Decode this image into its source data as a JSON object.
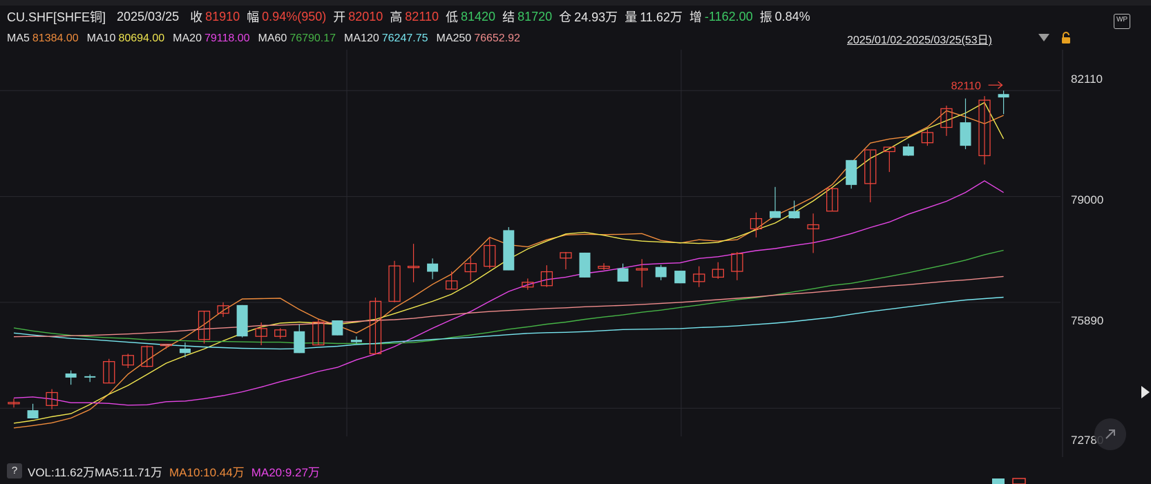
{
  "header": {
    "symbol": "CU.SHF[SHFE铜]",
    "date": "2025/03/25",
    "close_label": "收",
    "close_value": "81910",
    "range_label": "幅",
    "range_value": "0.94%(950)",
    "open_label": "开",
    "open_value": "82010",
    "high_label": "高",
    "high_value": "82110",
    "low_label": "低",
    "low_value": "81420",
    "settle_label": "结",
    "settle_value": "81720",
    "oi_label": "仓",
    "oi_value": "24.93万",
    "vol_label": "量",
    "vol_value": "11.62万",
    "incr_label": "增",
    "incr_value": "-1162.00",
    "amp_label": "振",
    "amp_value": "0.84%"
  },
  "ma_legend": [
    {
      "name": "MA5",
      "value": "81384.00",
      "color": "#f08c3c"
    },
    {
      "name": "MA10",
      "value": "80694.00",
      "color": "#f0e650"
    },
    {
      "name": "MA20",
      "value": "79118.00",
      "color": "#e646e6"
    },
    {
      "name": "MA60",
      "value": "76790.17",
      "color": "#46b446"
    },
    {
      "name": "MA120",
      "value": "76247.75",
      "color": "#78e6f0"
    },
    {
      "name": "MA250",
      "value": "76652.92",
      "color": "#f08c8c"
    }
  ],
  "date_range": "2025/01/02-2025/03/25(53日)",
  "wp_badge": "WP",
  "help_button": "?",
  "volume_legend": {
    "vol": "VOL:11.62万",
    "ma5": "MA5:11.71万",
    "ma10": "MA10:10.44万",
    "ma20": "MA20:9.27万",
    "ma10_color": "#f08c3c",
    "ma20_color": "#e646e6"
  },
  "colors": {
    "up": "#f0463c",
    "down": "#78d2d2",
    "grid": "#2a2a30",
    "background": "#131317"
  },
  "chart_data": {
    "type": "candlestick",
    "y_ticks": [
      "82110",
      "79000",
      "75890",
      "72780"
    ],
    "ylim": [
      72480,
      82420
    ],
    "high_marker": "82110",
    "grid": true,
    "candles": [
      {
        "o": 72950,
        "h": 73060,
        "l": 72800,
        "c": 72950
      },
      {
        "o": 72720,
        "h": 72910,
        "l": 72480,
        "c": 72480
      },
      {
        "o": 72860,
        "h": 73340,
        "l": 72750,
        "c": 73240
      },
      {
        "o": 73800,
        "h": 73890,
        "l": 73470,
        "c": 73680
      },
      {
        "o": 73720,
        "h": 73770,
        "l": 73550,
        "c": 73690
      },
      {
        "o": 73520,
        "h": 74230,
        "l": 73520,
        "c": 74150
      },
      {
        "o": 74050,
        "h": 74380,
        "l": 73960,
        "c": 74330
      },
      {
        "o": 74010,
        "h": 74620,
        "l": 73980,
        "c": 74590
      },
      {
        "o": 74630,
        "h": 74640,
        "l": 74520,
        "c": 74660
      },
      {
        "o": 74530,
        "h": 74710,
        "l": 74270,
        "c": 74400
      },
      {
        "o": 74800,
        "h": 75640,
        "l": 74680,
        "c": 75630
      },
      {
        "o": 75570,
        "h": 75890,
        "l": 75460,
        "c": 75790
      },
      {
        "o": 75810,
        "h": 75810,
        "l": 74860,
        "c": 74890
      },
      {
        "o": 74890,
        "h": 75300,
        "l": 74630,
        "c": 75120
      },
      {
        "o": 74890,
        "h": 75130,
        "l": 74820,
        "c": 75080
      },
      {
        "o": 75040,
        "h": 75240,
        "l": 74400,
        "c": 74400
      },
      {
        "o": 74640,
        "h": 75390,
        "l": 74640,
        "c": 75310
      },
      {
        "o": 75360,
        "h": 75360,
        "l": 74920,
        "c": 74920
      },
      {
        "o": 74790,
        "h": 74890,
        "l": 74680,
        "c": 74720
      },
      {
        "o": 74380,
        "h": 76030,
        "l": 74380,
        "c": 75920
      },
      {
        "o": 75920,
        "h": 77110,
        "l": 75890,
        "c": 76960
      },
      {
        "o": 76930,
        "h": 77610,
        "l": 76480,
        "c": 76950
      },
      {
        "o": 77030,
        "h": 77180,
        "l": 76570,
        "c": 76790
      },
      {
        "o": 76280,
        "h": 76800,
        "l": 76280,
        "c": 76520
      },
      {
        "o": 76790,
        "h": 77220,
        "l": 76520,
        "c": 77030
      },
      {
        "o": 76950,
        "h": 77800,
        "l": 76880,
        "c": 77560
      },
      {
        "o": 78010,
        "h": 78100,
        "l": 76830,
        "c": 76830
      },
      {
        "o": 76340,
        "h": 76590,
        "l": 76260,
        "c": 76480
      },
      {
        "o": 76380,
        "h": 76980,
        "l": 76340,
        "c": 76790
      },
      {
        "o": 77190,
        "h": 77370,
        "l": 76860,
        "c": 77350
      },
      {
        "o": 77350,
        "h": 77350,
        "l": 76620,
        "c": 76620
      },
      {
        "o": 76890,
        "h": 77040,
        "l": 76840,
        "c": 76950
      },
      {
        "o": 76890,
        "h": 77030,
        "l": 76500,
        "c": 76500
      },
      {
        "o": 76870,
        "h": 77160,
        "l": 76330,
        "c": 76880
      },
      {
        "o": 76930,
        "h": 76990,
        "l": 76540,
        "c": 76630
      },
      {
        "o": 76820,
        "h": 76820,
        "l": 76450,
        "c": 76450
      },
      {
        "o": 76500,
        "h": 76950,
        "l": 76340,
        "c": 76720
      },
      {
        "o": 76630,
        "h": 77070,
        "l": 76580,
        "c": 76860
      },
      {
        "o": 76800,
        "h": 77370,
        "l": 76540,
        "c": 77320
      },
      {
        "o": 78050,
        "h": 78530,
        "l": 77800,
        "c": 78350
      },
      {
        "o": 78570,
        "h": 79280,
        "l": 78550,
        "c": 78370
      },
      {
        "o": 78570,
        "h": 78880,
        "l": 78350,
        "c": 78360
      },
      {
        "o": 78050,
        "h": 78500,
        "l": 77340,
        "c": 78170
      },
      {
        "o": 78570,
        "h": 79250,
        "l": 78580,
        "c": 79230
      },
      {
        "o": 80070,
        "h": 80070,
        "l": 79230,
        "c": 79340
      },
      {
        "o": 79380,
        "h": 80350,
        "l": 78830,
        "c": 80370
      },
      {
        "o": 80320,
        "h": 80330,
        "l": 79720,
        "c": 80450
      },
      {
        "o": 80470,
        "h": 80550,
        "l": 80190,
        "c": 80200
      },
      {
        "o": 80580,
        "h": 80970,
        "l": 80490,
        "c": 80880
      },
      {
        "o": 81030,
        "h": 81670,
        "l": 80780,
        "c": 81580
      },
      {
        "o": 81180,
        "h": 81880,
        "l": 80390,
        "c": 80490
      },
      {
        "o": 80200,
        "h": 81950,
        "l": 79940,
        "c": 81830
      },
      {
        "o": 82010,
        "h": 82110,
        "l": 81420,
        "c": 81910
      }
    ],
    "ma_lines": [
      {
        "name": "MA5",
        "values": [
          72200,
          72270,
          72350,
          72490,
          72740,
          73200,
          73780,
          74190,
          74560,
          74870,
          75240,
          75650,
          75990,
          76000,
          76010,
          75680,
          75400,
          75210,
          74990,
          75290,
          75730,
          76060,
          76420,
          76720,
          77240,
          77800,
          77580,
          77520,
          77730,
          77870,
          77890,
          77880,
          77890,
          77910,
          77710,
          77630,
          77730,
          77690,
          77730,
          78050,
          78440,
          78700,
          78980,
          79350,
          79990,
          80570,
          80690,
          80760,
          81040,
          81520,
          81340,
          81140,
          81384
        ]
      },
      {
        "name": "MA10",
        "values": [
          72340,
          72420,
          72530,
          72620,
          72890,
          73190,
          73450,
          73770,
          74100,
          74320,
          74520,
          74760,
          74980,
          75170,
          75280,
          75310,
          75280,
          75240,
          75310,
          75390,
          75560,
          75740,
          75920,
          76130,
          76440,
          76800,
          77160,
          77460,
          77690,
          77900,
          77950,
          77860,
          77750,
          77690,
          77660,
          77640,
          77620,
          77650,
          77810,
          78020,
          78220,
          78530,
          78870,
          79270,
          79700,
          80120,
          80410,
          80730,
          81000,
          81230,
          81450,
          81760,
          80694
        ]
      },
      {
        "name": "MA20",
        "values": [
          73080,
          73110,
          73050,
          72940,
          72940,
          72920,
          72870,
          72880,
          72970,
          72990,
          73060,
          73150,
          73260,
          73400,
          73560,
          73700,
          73860,
          73980,
          74200,
          74370,
          74590,
          74860,
          75130,
          75380,
          75620,
          75920,
          76210,
          76410,
          76560,
          76630,
          76740,
          76810,
          76900,
          77000,
          77030,
          77050,
          77180,
          77230,
          77320,
          77410,
          77470,
          77560,
          77640,
          77760,
          77910,
          78090,
          78250,
          78480,
          78670,
          78860,
          79120,
          79460,
          79118
        ]
      },
      {
        "name": "MA60",
        "values": [
          75140,
          75050,
          74980,
          74920,
          74880,
          74850,
          74830,
          74790,
          74780,
          74760,
          74740,
          74740,
          74730,
          74720,
          74720,
          74690,
          74700,
          74680,
          74680,
          74670,
          74690,
          74710,
          74770,
          74860,
          74930,
          75010,
          75100,
          75170,
          75250,
          75310,
          75390,
          75460,
          75520,
          75600,
          75660,
          75740,
          75810,
          75890,
          75970,
          76030,
          76110,
          76200,
          76290,
          76390,
          76450,
          76550,
          76650,
          76760,
          76880,
          77000,
          77130,
          77290,
          77420
        ]
      },
      {
        "name": "MA120",
        "values": [
          74990,
          74930,
          74880,
          74830,
          74800,
          74760,
          74720,
          74680,
          74640,
          74610,
          74580,
          74560,
          74540,
          74530,
          74520,
          74530,
          74570,
          74600,
          74650,
          74680,
          74730,
          74760,
          74800,
          74830,
          74860,
          74900,
          74940,
          74980,
          75000,
          75010,
          75030,
          75060,
          75090,
          75100,
          75110,
          75120,
          75150,
          75170,
          75200,
          75240,
          75280,
          75330,
          75390,
          75450,
          75540,
          75620,
          75690,
          75760,
          75830,
          75900,
          75960,
          76000,
          76040
        ]
      },
      {
        "name": "MA250",
        "values": [
          74880,
          74890,
          74890,
          74910,
          74920,
          74940,
          74960,
          74990,
          75020,
          75060,
          75110,
          75140,
          75170,
          75210,
          75220,
          75240,
          75270,
          75300,
          75330,
          75360,
          75380,
          75420,
          75480,
          75530,
          75580,
          75620,
          75650,
          75680,
          75710,
          75730,
          75760,
          75780,
          75800,
          75830,
          75860,
          75890,
          75930,
          75970,
          76010,
          76050,
          76100,
          76140,
          76180,
          76230,
          76280,
          76320,
          76370,
          76410,
          76460,
          76510,
          76550,
          76600,
          76650
        ]
      }
    ]
  }
}
